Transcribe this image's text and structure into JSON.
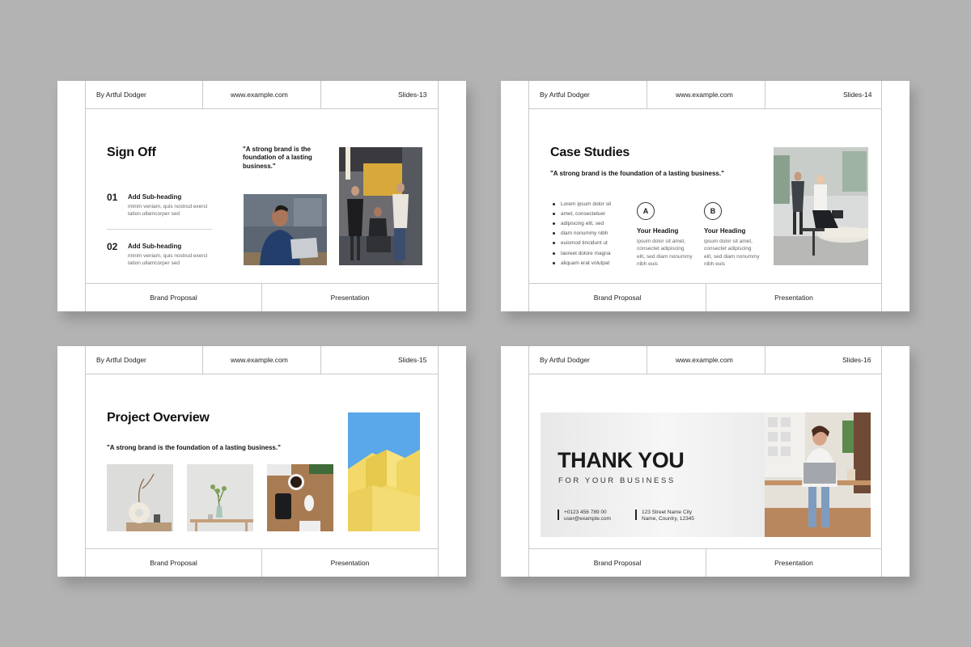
{
  "slides": [
    {
      "author": "By Artful Dodger",
      "website": "www.example.com",
      "slide_no": "Slides-13",
      "footer_left": "Brand Proposal",
      "footer_right": "Presentation",
      "title": "Sign Off",
      "quote": "\"A strong brand is the foundation of a lasting business.\"",
      "items": [
        {
          "num": "01",
          "heading": "Add Sub-heading",
          "text": "minim veniam, quis nostrud exerci tation ullamcorper sed"
        },
        {
          "num": "02",
          "heading": "Add Sub-heading",
          "text": "minim veniam, quis nostrud exerci tation ullamcorper sed"
        }
      ]
    },
    {
      "author": "By Artful Dodger",
      "website": "www.example.com",
      "slide_no": "Slides-14",
      "footer_left": "Brand Proposal",
      "footer_right": "Presentation",
      "title": "Case Studies",
      "quote": "\"A strong brand is the foundation of a lasting business.\"",
      "bullets": [
        "Lorem ipsum dolor sit",
        "amet, consectetuer",
        "adipiscing elit, sed",
        "diam nonummy nibh",
        "euismod tincidunt ut",
        "laoreet dolore magna",
        "aliquam erat volutpat"
      ],
      "cols": [
        {
          "letter": "A",
          "heading": "Your Heading",
          "text": "ipsum dolor sit amet, consectet adipiscing elit, sed diam nonummy nibh euis"
        },
        {
          "letter": "B",
          "heading": "Your Heading",
          "text": "ipsum dolor sit amet, consectet adipiscing elit, sed diam nonummy nibh euis"
        }
      ]
    },
    {
      "author": "By Artful Dodger",
      "website": "www.example.com",
      "slide_no": "Slides-15",
      "footer_left": "Brand Proposal",
      "footer_right": "Presentation",
      "title": "Project Overview",
      "quote": "\"A strong brand is the foundation of a lasting business.\""
    },
    {
      "author": "By Artful Dodger",
      "website": "www.example.com",
      "slide_no": "Slides-16",
      "footer_left": "Brand Proposal",
      "footer_right": "Presentation",
      "title": "THANK YOU",
      "subtitle": "FOR YOUR BUSINESS",
      "phone": "+0123 456 789 00",
      "email": "user@example.com",
      "street": "123 Street Name City",
      "region": "Name, Country, 12345"
    }
  ],
  "colors": {
    "page_bg": "#b3b3b3",
    "slide_bg": "#ffffff",
    "rule": "#c9c9c9",
    "sky_blue": "#5aa7ea",
    "building_yellow": "#f2d96a"
  }
}
